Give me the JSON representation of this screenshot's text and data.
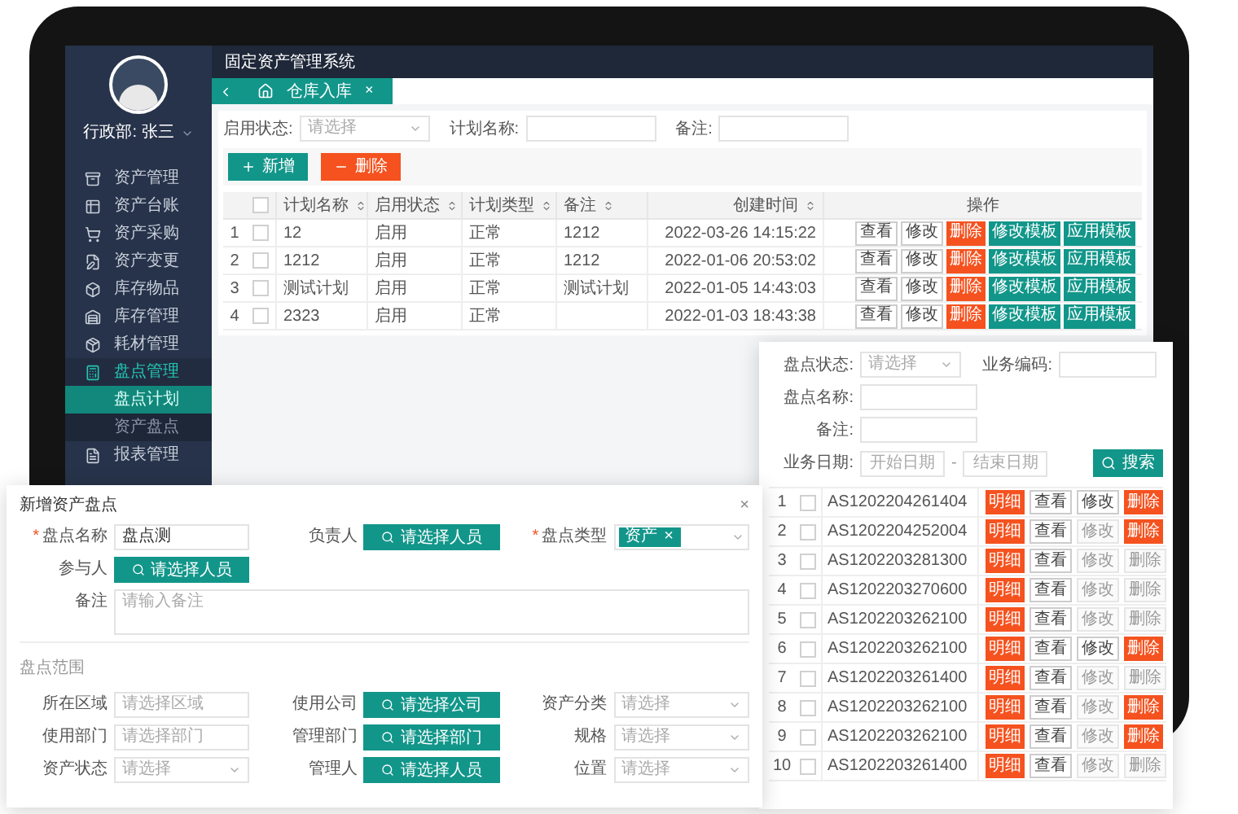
{
  "sidebar": {
    "user": "行政部: 张三",
    "items": [
      {
        "label": "资产管理",
        "expanded": false
      },
      {
        "label": "资产台账",
        "expanded": false
      },
      {
        "label": "资产采购",
        "expanded": false
      },
      {
        "label": "资产变更",
        "expanded": false
      },
      {
        "label": "库存物品",
        "expanded": false
      },
      {
        "label": "库存管理",
        "expanded": false
      },
      {
        "label": "耗材管理",
        "expanded": false
      },
      {
        "label": "盘点管理",
        "expanded": true,
        "children": [
          {
            "label": "盘点计划",
            "selected": true
          },
          {
            "label": "资产盘点",
            "selected": false
          }
        ]
      },
      {
        "label": "报表管理",
        "expanded": false
      }
    ]
  },
  "header": {
    "title": "固定资产管理系统"
  },
  "tabs": [
    {
      "label": "仓库入库",
      "close": "×",
      "selected": true
    }
  ],
  "filters": [
    {
      "label": "启用状态:",
      "kind": "select",
      "placeholder": "请选择"
    },
    {
      "label": "计划名称:",
      "kind": "input"
    },
    {
      "label": "备注:",
      "kind": "input"
    }
  ],
  "toolbar": [
    {
      "label": "新增",
      "kind": "add"
    },
    {
      "label": "删除",
      "kind": "remove"
    }
  ],
  "table": {
    "header_checked": false,
    "columns": [
      {
        "label": "计划名称",
        "sortable": true
      },
      {
        "label": "启用状态",
        "sortable": true
      },
      {
        "label": "计划类型",
        "sortable": true
      },
      {
        "label": "备注",
        "sortable": true
      },
      {
        "label": "创建时间",
        "sortable": true
      },
      {
        "label": "操作",
        "sortable": false
      }
    ],
    "rows": [
      {
        "index": "1",
        "checked": false,
        "cells": [
          "12",
          "启用",
          "正常",
          "1212",
          "2022-03-26 14:15:22"
        ],
        "actions": [
          {
            "label": "查看",
            "kind": "plain"
          },
          {
            "label": "修改",
            "kind": "plain"
          },
          {
            "label": "删除",
            "kind": "danger"
          },
          {
            "label": "修改模板",
            "kind": "primary"
          },
          {
            "label": "应用模板",
            "kind": "primary"
          }
        ]
      },
      {
        "index": "2",
        "checked": false,
        "cells": [
          "1212",
          "启用",
          "正常",
          "1212",
          "2022-01-06 20:53:02"
        ],
        "actions": [
          {
            "label": "查看",
            "kind": "plain"
          },
          {
            "label": "修改",
            "kind": "plain"
          },
          {
            "label": "删除",
            "kind": "danger"
          },
          {
            "label": "修改模板",
            "kind": "primary"
          },
          {
            "label": "应用模板",
            "kind": "primary"
          }
        ]
      },
      {
        "index": "3",
        "checked": false,
        "cells": [
          "测试计划",
          "启用",
          "正常",
          "测试计划",
          "2022-01-05 14:43:03"
        ],
        "actions": [
          {
            "label": "查看",
            "kind": "plain"
          },
          {
            "label": "修改",
            "kind": "plain"
          },
          {
            "label": "删除",
            "kind": "danger"
          },
          {
            "label": "修改模板",
            "kind": "primary"
          },
          {
            "label": "应用模板",
            "kind": "primary"
          }
        ]
      },
      {
        "index": "4",
        "checked": false,
        "cells": [
          "2323",
          "启用",
          "正常",
          "",
          "2022-01-03 18:43:38"
        ],
        "actions": [
          {
            "label": "查看",
            "kind": "plain"
          },
          {
            "label": "修改",
            "kind": "plain"
          },
          {
            "label": "删除",
            "kind": "danger"
          },
          {
            "label": "修改模板",
            "kind": "primary"
          },
          {
            "label": "应用模板",
            "kind": "primary"
          }
        ]
      }
    ]
  },
  "stocktake_panel": {
    "filters": [
      {
        "label": "盘点状态:",
        "kind": "select",
        "placeholder": "请选择"
      },
      {
        "label": "业务编码:",
        "kind": "input"
      },
      {
        "label": "盘点名称:",
        "kind": "input"
      },
      {
        "label": "备注:",
        "kind": "input"
      }
    ],
    "date_label": "业务日期:",
    "date_start": "开始日期",
    "date_separator": "-",
    "date_end": "结束日期",
    "search_button": "搜索",
    "rows": [
      {
        "index": "1",
        "checked": false,
        "code": "AS1202204261404",
        "actions": [
          {
            "label": "明细",
            "kind": "danger",
            "disabled": false
          },
          {
            "label": "查看",
            "kind": "plain",
            "disabled": false
          },
          {
            "label": "修改",
            "kind": "plain",
            "disabled": false
          },
          {
            "label": "删除",
            "kind": "danger",
            "disabled": false
          }
        ]
      },
      {
        "index": "2",
        "checked": false,
        "code": "AS1202204252004",
        "actions": [
          {
            "label": "明细",
            "kind": "danger",
            "disabled": false
          },
          {
            "label": "查看",
            "kind": "plain",
            "disabled": false
          },
          {
            "label": "修改",
            "kind": "plain",
            "disabled": true
          },
          {
            "label": "删除",
            "kind": "danger",
            "disabled": false
          }
        ]
      },
      {
        "index": "3",
        "checked": false,
        "code": "AS1202203281300",
        "actions": [
          {
            "label": "明细",
            "kind": "danger",
            "disabled": false
          },
          {
            "label": "查看",
            "kind": "plain",
            "disabled": false
          },
          {
            "label": "修改",
            "kind": "plain",
            "disabled": true
          },
          {
            "label": "删除",
            "kind": "danger",
            "disabled": true
          }
        ]
      },
      {
        "index": "4",
        "checked": false,
        "code": "AS1202203270600",
        "actions": [
          {
            "label": "明细",
            "kind": "danger",
            "disabled": false
          },
          {
            "label": "查看",
            "kind": "plain",
            "disabled": false
          },
          {
            "label": "修改",
            "kind": "plain",
            "disabled": true
          },
          {
            "label": "删除",
            "kind": "danger",
            "disabled": true
          }
        ]
      },
      {
        "index": "5",
        "checked": false,
        "code": "AS1202203262100",
        "actions": [
          {
            "label": "明细",
            "kind": "danger",
            "disabled": false
          },
          {
            "label": "查看",
            "kind": "plain",
            "disabled": false
          },
          {
            "label": "修改",
            "kind": "plain",
            "disabled": true
          },
          {
            "label": "删除",
            "kind": "danger",
            "disabled": true
          }
        ]
      },
      {
        "index": "6",
        "checked": false,
        "code": "AS1202203262100",
        "actions": [
          {
            "label": "明细",
            "kind": "danger",
            "disabled": false
          },
          {
            "label": "查看",
            "kind": "plain",
            "disabled": false
          },
          {
            "label": "修改",
            "kind": "plain",
            "disabled": false
          },
          {
            "label": "删除",
            "kind": "danger",
            "disabled": false
          }
        ]
      },
      {
        "index": "7",
        "checked": false,
        "code": "AS1202203261400",
        "actions": [
          {
            "label": "明细",
            "kind": "danger",
            "disabled": false
          },
          {
            "label": "查看",
            "kind": "plain",
            "disabled": false
          },
          {
            "label": "修改",
            "kind": "plain",
            "disabled": true
          },
          {
            "label": "删除",
            "kind": "danger",
            "disabled": true
          }
        ]
      },
      {
        "index": "8",
        "checked": false,
        "code": "AS1202203262100",
        "actions": [
          {
            "label": "明细",
            "kind": "danger",
            "disabled": false
          },
          {
            "label": "查看",
            "kind": "plain",
            "disabled": false
          },
          {
            "label": "修改",
            "kind": "plain",
            "disabled": true
          },
          {
            "label": "删除",
            "kind": "danger",
            "disabled": false
          }
        ]
      },
      {
        "index": "9",
        "checked": false,
        "code": "AS1202203262100",
        "actions": [
          {
            "label": "明细",
            "kind": "danger",
            "disabled": false
          },
          {
            "label": "查看",
            "kind": "plain",
            "disabled": false
          },
          {
            "label": "修改",
            "kind": "plain",
            "disabled": true
          },
          {
            "label": "删除",
            "kind": "danger",
            "disabled": false
          }
        ]
      },
      {
        "index": "10",
        "checked": false,
        "code": "AS1202203261400",
        "actions": [
          {
            "label": "明细",
            "kind": "danger",
            "disabled": false
          },
          {
            "label": "查看",
            "kind": "plain",
            "disabled": false
          },
          {
            "label": "修改",
            "kind": "plain",
            "disabled": true
          },
          {
            "label": "删除",
            "kind": "danger",
            "disabled": true
          }
        ]
      }
    ]
  },
  "form_dialog": {
    "title": "新增资产盘点",
    "close": "×",
    "fields": [
      {
        "label": "盘点名称",
        "required_mark": "*",
        "kind": "input",
        "value": "盘点测"
      },
      {
        "label": "负责人",
        "kind": "picker",
        "value": "请选择人员"
      },
      {
        "label": "盘点类型",
        "required_mark": "*",
        "kind": "tag",
        "value": "资产",
        "remove": "×"
      },
      {
        "label": "参与人",
        "kind": "picker",
        "value": "请选择人员"
      },
      {
        "label": "备注",
        "kind": "textarea",
        "placeholder": "请输入备注"
      }
    ],
    "section": "盘点范围",
    "range_fields": [
      {
        "label": "所在区域",
        "kind": "input",
        "placeholder": "请选择区域"
      },
      {
        "label": "使用公司",
        "kind": "picker",
        "value": "请选择公司"
      },
      {
        "label": "资产分类",
        "kind": "select",
        "placeholder": "请选择"
      },
      {
        "label": "使用部门",
        "kind": "input",
        "placeholder": "请选择部门"
      },
      {
        "label": "管理部门",
        "kind": "picker",
        "value": "请选择部门"
      },
      {
        "label": "规格",
        "kind": "select",
        "placeholder": "请选择"
      },
      {
        "label": "资产状态",
        "kind": "select",
        "placeholder": "请选择"
      },
      {
        "label": "管理人",
        "kind": "picker",
        "value": "请选择人员"
      },
      {
        "label": "位置",
        "kind": "select",
        "placeholder": "请选择"
      }
    ]
  }
}
